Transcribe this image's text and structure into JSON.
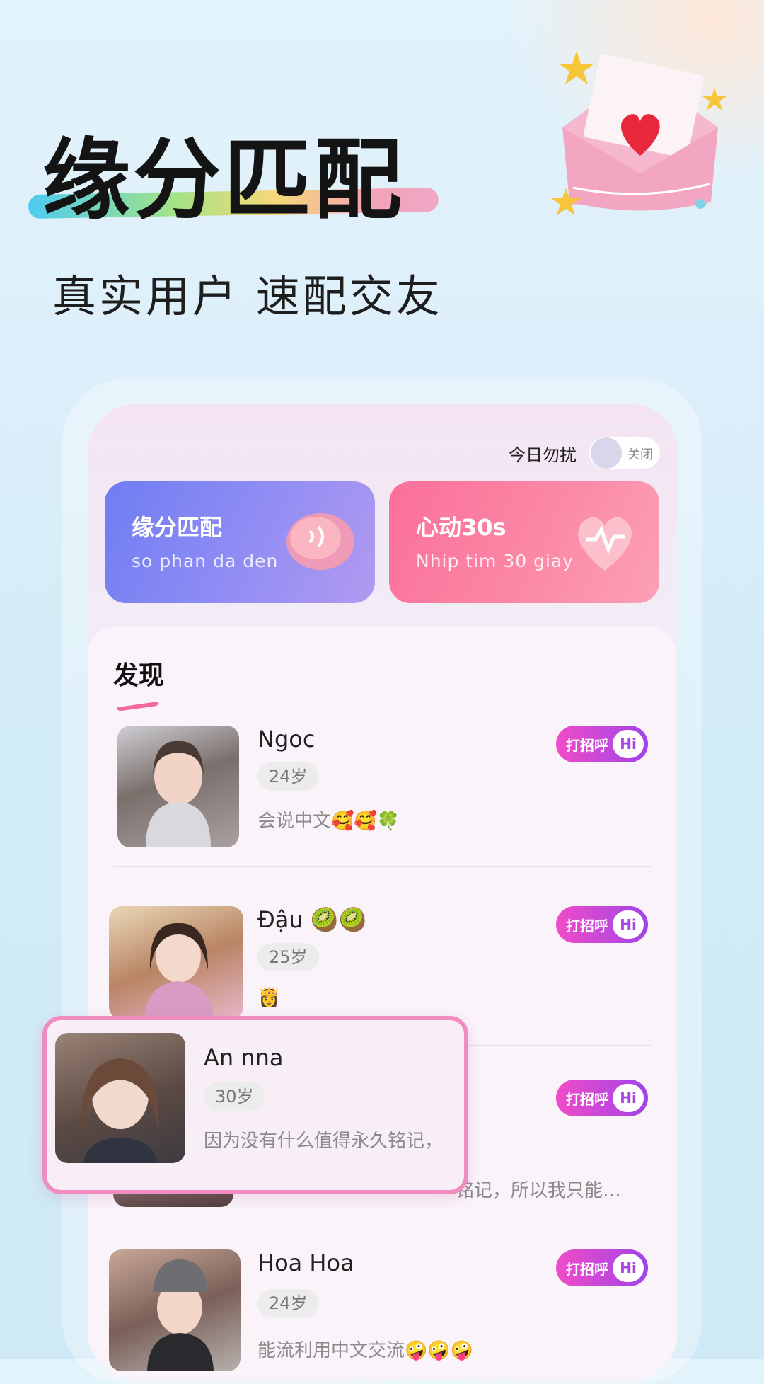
{
  "header": {
    "title": "缘分匹配",
    "subtitle": "真实用户 速配交友"
  },
  "dnd": {
    "label": "今日勿扰",
    "toggle_text": "关闭"
  },
  "features": [
    {
      "title": "缘分匹配",
      "subtitle": "so phan da den"
    },
    {
      "title": "心动30s",
      "subtitle": "Nhip tim 30 giay"
    }
  ],
  "discover": {
    "title": "发现"
  },
  "users": [
    {
      "name": "Ngoc",
      "age": "24岁",
      "bio": "会说中文🥰🥰🍀",
      "hi": "打招呼",
      "hi_icon": "Hi"
    },
    {
      "name": "Đậu 🥝🥝",
      "age": "25岁",
      "bio": "👸",
      "hi": "打招呼",
      "hi_icon": "Hi"
    },
    {
      "name": "",
      "age": "",
      "bio": "铭记，所以我只能…",
      "hi": "打招呼",
      "hi_icon": "Hi"
    },
    {
      "name": "Hoa Hoa",
      "age": "24岁",
      "bio": "能流利用中文交流🤪🤪🤪",
      "hi": "打招呼",
      "hi_icon": "Hi"
    }
  ],
  "popup": {
    "name": "An nna",
    "age": "30岁",
    "bio": "因为没有什么值得永久铭记，"
  },
  "colors": {
    "accent_pink": "#f04cc8",
    "accent_purple": "#a044e8",
    "card_left": "#6f7df2",
    "card_right": "#fb6f9a",
    "highlight_border": "#f08cc0"
  }
}
